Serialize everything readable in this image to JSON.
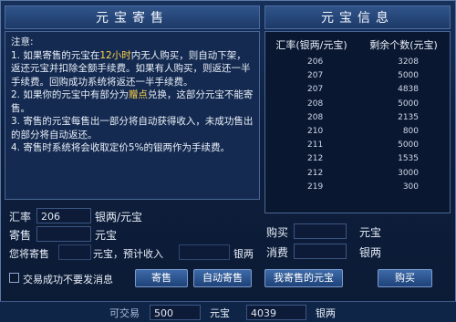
{
  "left_title": "元宝寄售",
  "right_title": "元宝信息",
  "notice": {
    "heading": "注意:",
    "item1_pre": "1. 如果寄售的元宝在",
    "item1_hl": "12小时",
    "item1_post": "内无人购买，则自动下架，返还元宝并扣除全额手续费。如果有人购买，则返还一半手续费。回购成功系统将返还一半手续费。",
    "item2_pre": "2. 如果你的元宝中有部分为",
    "item2_hl": "赠点",
    "item2_post": "兑换，这部分元宝不能寄售。",
    "item3": "3. 寄售的元宝每售出一部分将自动获得收入，未成功售出的部分将自动返还。",
    "item4": "4. 寄售时系统将会收取定价5%的银两作为手续费。"
  },
  "list": {
    "col_rate": "汇率(银两/元宝)",
    "col_remain": "剩余个数(元宝)",
    "rows": [
      {
        "rate": "206",
        "remain": "3208"
      },
      {
        "rate": "207",
        "remain": "5000"
      },
      {
        "rate": "207",
        "remain": "4838"
      },
      {
        "rate": "208",
        "remain": "5000"
      },
      {
        "rate": "208",
        "remain": "2135"
      },
      {
        "rate": "210",
        "remain": "800"
      },
      {
        "rate": "211",
        "remain": "5000"
      },
      {
        "rate": "212",
        "remain": "1535"
      },
      {
        "rate": "212",
        "remain": "3000"
      },
      {
        "rate": "219",
        "remain": "300"
      }
    ]
  },
  "sell": {
    "rate_label": "汇率",
    "rate_value": "206",
    "rate_unit": "银两/元宝",
    "amount_label": "寄售",
    "amount_value": "",
    "amount_unit": "元宝",
    "hint_pre": "您将寄售",
    "hint_mid": "元宝，预计收入",
    "hint_unit": "银两"
  },
  "buy": {
    "buy_label": "购买",
    "buy_unit": "元宝",
    "cost_label": "消费",
    "cost_unit": "银两"
  },
  "checkbox_label": "交易成功不要发消息",
  "buttons": {
    "consign": "寄售",
    "auto_consign": "自动寄售",
    "my_consigned": "我寄售的元宝",
    "buy": "购买"
  },
  "footer": {
    "tradable_label": "可交易",
    "tradable_value": "500",
    "unit1": "元宝",
    "silver_value": "4039",
    "unit2": "银两"
  }
}
